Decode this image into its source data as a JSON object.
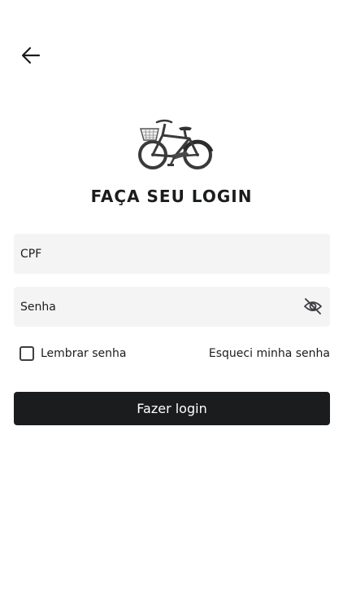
{
  "header": {
    "back_icon": "arrow-left-icon"
  },
  "logo": {
    "icon": "bicycle-icon"
  },
  "page_title": "FAÇA SEU LOGIN",
  "form": {
    "cpf_placeholder": "CPF",
    "cpf_value": "",
    "senha_placeholder": "Senha",
    "senha_value": "",
    "password_toggle_icon": "eye-off-icon",
    "remember_label": "Lembrar senha",
    "remember_checked": false,
    "forgot_label": "Esqueci minha senha",
    "submit_label": "Fazer login"
  },
  "colors": {
    "primary": "#1b1c1e",
    "field_bg": "#f4f4f4",
    "background": "#ffffff"
  }
}
